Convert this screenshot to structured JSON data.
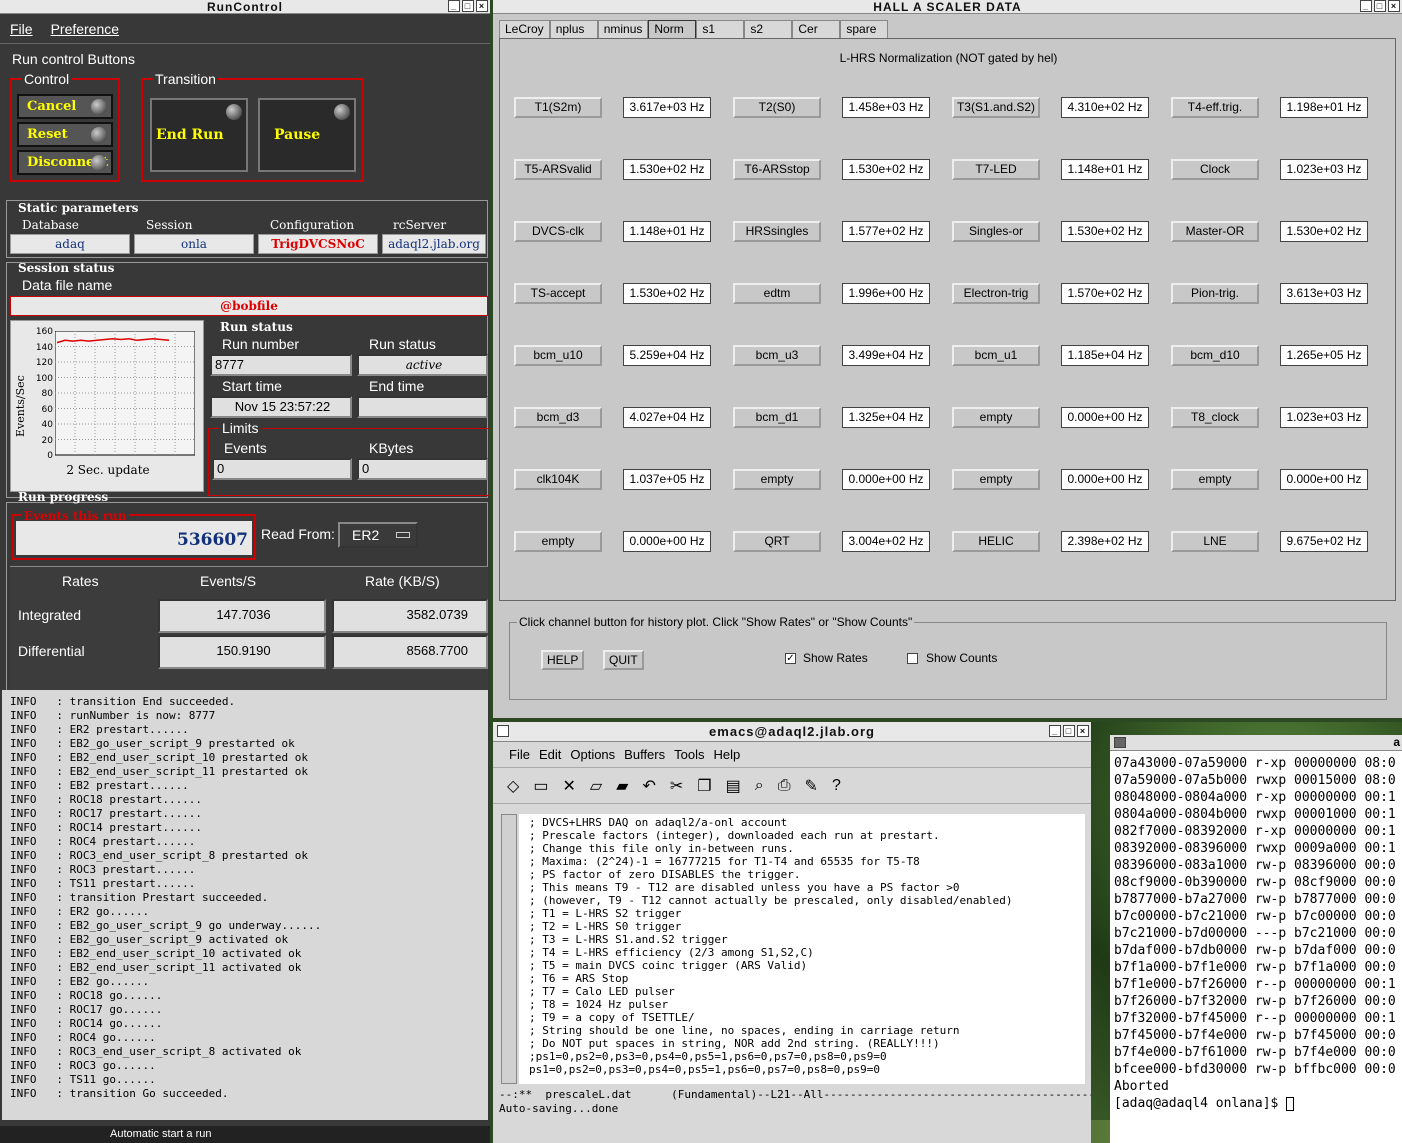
{
  "runcontrol": {
    "title": "RunControl",
    "menu": [
      "File",
      "Preference"
    ],
    "buttons_title": "Run control Buttons",
    "control_label": "Control",
    "transition_label": "Transition",
    "control_buttons": [
      "Cancel",
      "Reset",
      "Disconnect"
    ],
    "transition_buttons": [
      "End Run",
      "Pause"
    ],
    "static_params_title": "Static parameters",
    "static_params": [
      {
        "label": "Database",
        "value": "adaq"
      },
      {
        "label": "Session",
        "value": "onla"
      },
      {
        "label": "Configuration",
        "value": "TrigDVCSNoC"
      },
      {
        "label": "rcServer",
        "value": "adaql2.jlab.org"
      }
    ],
    "session_status_title": "Session status",
    "data_file_label": "Data file name",
    "data_file_value": "@bobfile",
    "graph": {
      "ylabel": "Events/Sec",
      "yticks": [
        "160",
        "140",
        "120",
        "100",
        "80",
        "60",
        "40",
        "20",
        "0"
      ],
      "caption": "2 Sec. update"
    },
    "run_status_title": "Run status",
    "run_number_label": "Run number",
    "run_number": "8777",
    "run_status_label": "Run status",
    "run_status": "active",
    "start_time_label": "Start time",
    "start_time": "Nov 15 23:57:22",
    "end_time_label": "End time",
    "end_time": "",
    "limits_label": "Limits",
    "events_label": "Events",
    "events_value": "0",
    "kbytes_label": "KBytes",
    "kbytes_value": "0",
    "run_progress_title": "Run progress",
    "events_this_run_label": "Events this run",
    "events_this_run": "536607",
    "read_from_label": "Read From:",
    "read_from_value": "ER2",
    "rates_header": [
      "Rates",
      "Events/S",
      "Rate (KB/S)"
    ],
    "rates": [
      {
        "label": "Integrated",
        "events": "147.7036",
        "kb": "3582.0739"
      },
      {
        "label": "Differential",
        "events": "150.9190",
        "kb": "8568.7700"
      }
    ],
    "log": "INFO   : transition End succeeded.\nINFO   : runNumber is now: 8777\nINFO   : ER2 prestart......\nINFO   : EB2_go_user_script_9 prestarted ok\nINFO   : EB2_end_user_script_10 prestarted ok\nINFO   : EB2_end_user_script_11 prestarted ok\nINFO   : EB2 prestart......\nINFO   : ROC18 prestart......\nINFO   : ROC17 prestart......\nINFO   : ROC14 prestart......\nINFO   : ROC4 prestart......\nINFO   : ROC3_end_user_script_8 prestarted ok\nINFO   : ROC3 prestart......\nINFO   : TS11 prestart......\nINFO   : transition Prestart succeeded.\nINFO   : ER2 go......\nINFO   : EB2_go_user_script_9 go underway......\nINFO   : EB2_go_user_script_9 activated ok\nINFO   : EB2_end_user_script_10 activated ok\nINFO   : EB2_end_user_script_11 activated ok\nINFO   : EB2 go......\nINFO   : ROC18 go......\nINFO   : ROC17 go......\nINFO   : ROC14 go......\nINFO   : ROC4 go......\nINFO   : ROC3_end_user_script_8 activated ok\nINFO   : ROC3 go......\nINFO   : TS11 go......\nINFO   : transition Go succeeded.",
    "footer": "Automatic start a run"
  },
  "scaler": {
    "title": "HALL  A  SCALER  DATA",
    "tabs": [
      "LeCroy",
      "nplus",
      "nminus",
      "Norm",
      "s1",
      "s2",
      "Cer",
      "spare"
    ],
    "active_tab": "Norm",
    "heading": "L-HRS Normalization (NOT gated by hel)",
    "channels": [
      {
        "name": "T1(S2m)",
        "value": "3.617e+03 Hz"
      },
      {
        "name": "T2(S0)",
        "value": "1.458e+03 Hz"
      },
      {
        "name": "T3(S1.and.S2)",
        "value": "4.310e+02 Hz"
      },
      {
        "name": "T4-eff.trig.",
        "value": "1.198e+01 Hz"
      },
      {
        "name": "T5-ARSvalid",
        "value": "1.530e+02 Hz"
      },
      {
        "name": "T6-ARSstop",
        "value": "1.530e+02 Hz"
      },
      {
        "name": "T7-LED",
        "value": "1.148e+01 Hz"
      },
      {
        "name": "Clock",
        "value": "1.023e+03 Hz"
      },
      {
        "name": "DVCS-clk",
        "value": "1.148e+01 Hz"
      },
      {
        "name": "HRSsingles",
        "value": "1.577e+02 Hz"
      },
      {
        "name": "Singles-or",
        "value": "1.530e+02 Hz"
      },
      {
        "name": "Master-OR",
        "value": "1.530e+02 Hz"
      },
      {
        "name": "TS-accept",
        "value": "1.530e+02 Hz"
      },
      {
        "name": "edtm",
        "value": "1.996e+00 Hz"
      },
      {
        "name": "Electron-trig",
        "value": "1.570e+02 Hz"
      },
      {
        "name": "Pion-trig.",
        "value": "3.613e+03 Hz"
      },
      {
        "name": "bcm_u10",
        "value": "5.259e+04 Hz"
      },
      {
        "name": "bcm_u3",
        "value": "3.499e+04 Hz"
      },
      {
        "name": "bcm_u1",
        "value": "1.185e+04 Hz"
      },
      {
        "name": "bcm_d10",
        "value": "1.265e+05 Hz"
      },
      {
        "name": "bcm_d3",
        "value": "4.027e+04 Hz"
      },
      {
        "name": "bcm_d1",
        "value": "1.325e+04 Hz"
      },
      {
        "name": "empty",
        "value": "0.000e+00 Hz"
      },
      {
        "name": "T8_clock",
        "value": "1.023e+03 Hz"
      },
      {
        "name": "clk104K",
        "value": "1.037e+05 Hz"
      },
      {
        "name": "empty",
        "value": "0.000e+00 Hz"
      },
      {
        "name": "empty",
        "value": "0.000e+00 Hz"
      },
      {
        "name": "empty",
        "value": "0.000e+00 Hz"
      },
      {
        "name": "empty",
        "value": "0.000e+00 Hz"
      },
      {
        "name": "QRT",
        "value": "3.004e+02 Hz"
      },
      {
        "name": "HELIC",
        "value": "2.398e+02 Hz"
      },
      {
        "name": "LNE",
        "value": "9.675e+02 Hz"
      }
    ],
    "hint": "Click channel button for history plot.  Click \"Show Rates\" or \"Show Counts\"",
    "help_button": "HELP",
    "quit_button": "QUIT",
    "show_rates_label": "Show Rates",
    "show_rates_checked": true,
    "show_counts_label": "Show Counts",
    "show_counts_checked": false
  },
  "emacs": {
    "title": "emacs@adaql2.jlab.org",
    "menu": [
      "File",
      "Edit",
      "Options",
      "Buffers",
      "Tools",
      "Help"
    ],
    "text": "; DVCS+LHRS DAQ on adaql2/a-onl account\n; Prescale factors (integer), downloaded each run at prestart.\n; Change this file only in-between runs.\n; Maxima: (2^24)-1 = 16777215 for T1-T4 and 65535 for T5-T8\n; PS factor of zero DISABLES the trigger.\n; This means T9 - T12 are disabled unless you have a PS factor >0\n; (however, T9 - T12 cannot actually be prescaled, only disabled/enabled)\n; T1 = L-HRS S2 trigger\n; T2 = L-HRS S0 trigger\n; T3 = L-HRS S1.and.S2 trigger\n; T4 = L-HRS efficiency (2/3 among S1,S2,C)\n; T5 = main DVCS coinc trigger (ARS Valid)\n; T6 = ARS Stop\n; T7 = Calo LED pulser\n; T8 = 1024 Hz pulser\n; T9 = a copy of TSETTLE/\n; String should be one line, no spaces, ending in carriage return\n; Do NOT put spaces in string, NOR add 2nd string. (REALLY!!!)\n;ps1=0,ps2=0,ps3=0,ps4=0,ps5=1,ps6=0,ps7=0,ps8=0,ps9=0\nps1=0,ps2=0,ps3=0,ps4=0,ps5=1,ps6=0,ps7=0,ps8=0,ps9=0\n",
    "modeline": "--:**  prescaleL.dat      (Fundamental)--L21--All------------------------------------------",
    "minibuffer": "Auto-saving...done"
  },
  "xterm": {
    "title": "a",
    "text": "07a43000-07a59000 r-xp 00000000 08:0\n07a59000-07a5b000 rwxp 00015000 08:0\n08048000-0804a000 r-xp 00000000 00:1\n0804a000-0804b000 rwxp 00001000 00:1\n082f7000-08392000 r-xp 00000000 00:1\n08392000-08396000 rwxp 0009a000 00:1\n08396000-083a1000 rw-p 08396000 00:0\n08cf9000-0b390000 rw-p 08cf9000 00:0\nb7877000-b7a27000 rw-p b7877000 00:0\nb7c00000-b7c21000 rw-p b7c00000 00:0\nb7c21000-b7d00000 ---p b7c21000 00:0\nb7daf000-b7db0000 rw-p b7daf000 00:0\nb7f1a000-b7f1e000 rw-p b7f1a000 00:0\nb7f1e000-b7f26000 r--p 00000000 00:1\nb7f26000-b7f32000 rw-p b7f26000 00:0\nb7f32000-b7f45000 r--p 00000000 00:1\nb7f45000-b7f4e000 rw-p b7f45000 00:0\nb7f4e000-b7f61000 rw-p b7f4e000 00:0\nbfcee000-bfd30000 rw-p bffbc000 00:0\nAborted\n[adaq@adaql4 onlana]$ "
  },
  "chart_data": {
    "type": "line",
    "ylabel": "Events/Sec",
    "ylim": [
      0,
      160
    ],
    "caption": "2 Sec. update",
    "series": [
      {
        "values": [
          145,
          148,
          147,
          148,
          147,
          148,
          149,
          150,
          149,
          150,
          148,
          149,
          150,
          149,
          148
        ]
      }
    ]
  }
}
